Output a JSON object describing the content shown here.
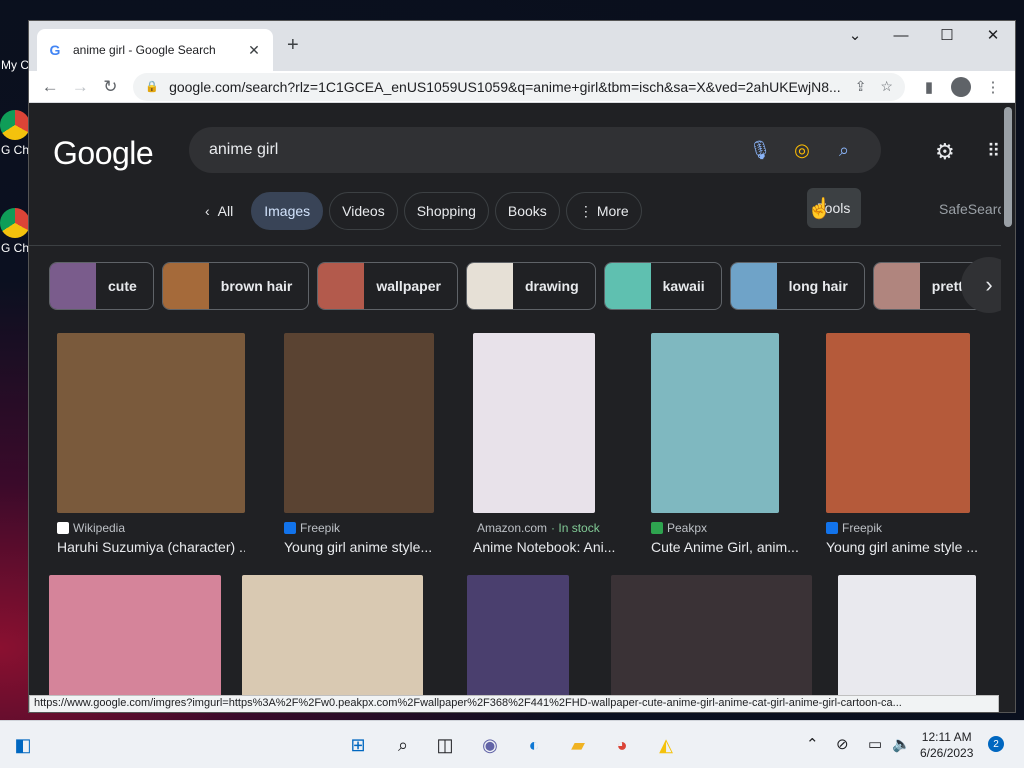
{
  "desktop": {
    "icons": [
      {
        "label": "My C"
      },
      {
        "label": "G Ch"
      },
      {
        "label": "G Ch"
      }
    ]
  },
  "browser": {
    "tab": {
      "title": "anime girl - Google Search",
      "close": "✕"
    },
    "new_tab": "+",
    "window_controls": {
      "dropdown": "⌄",
      "minimize": "—",
      "maximize": "☐",
      "close": "✕"
    },
    "url": "google.com/search?rlz=1C1GCEA_enUS1059US1059&q=anime+girl&tbm=isch&sa=X&ved=2ahUKEwjN8..."
  },
  "search": {
    "logo": "Google",
    "query": "anime girl"
  },
  "filters": {
    "all": "All",
    "items": [
      "Images",
      "Videos",
      "Shopping",
      "Books",
      "More"
    ],
    "tools": "Tools",
    "safesearch": "SafeSearch"
  },
  "related": [
    {
      "label": "cute",
      "color": "#7a5c8c"
    },
    {
      "label": "brown hair",
      "color": "#a56a3a"
    },
    {
      "label": "wallpaper",
      "color": "#b35a4c"
    },
    {
      "label": "drawing",
      "color": "#e6e0d6"
    },
    {
      "label": "kawaii",
      "color": "#5fc0b0"
    },
    {
      "label": "long hair",
      "color": "#6fa3c8"
    },
    {
      "label": "pretty",
      "color": "#b0857e"
    }
  ],
  "results": [
    {
      "source": "Wikipedia",
      "caption": "Haruhi Suzumiya (character) ...",
      "color": "#7a5a3c",
      "fav": "#ffffff"
    },
    {
      "source": "Freepik",
      "caption": "Young girl anime style...",
      "color": "#5a4332",
      "fav": "#1273eb"
    },
    {
      "source": "Amazon.com",
      "stock": "· In stock",
      "caption": "Anime Notebook: Ani...",
      "color": "#e8e2ea",
      "fav": "#ff9900"
    },
    {
      "source": "Peakpx",
      "caption": "Cute Anime Girl, anim...",
      "color": "#7fb8c0",
      "fav": "#2ea44f"
    },
    {
      "source": "Freepik",
      "caption": "Young girl anime style ...",
      "color": "#b55a3a",
      "fav": "#1273eb"
    },
    {
      "color": "#d5849a"
    },
    {
      "color": "#d9c9b2"
    },
    {
      "color": "#4a3f6e"
    },
    {
      "color": "#3a3236"
    },
    {
      "color": "#2a2f4a"
    }
  ],
  "status_url": "https://www.google.com/imgres?imgurl=https%3A%2F%2Fw0.peakpx.com%2Fwallpaper%2F368%2F441%2FHD-wallpaper-cute-anime-girl-anime-cat-girl-anime-girl-cartoon-ca...",
  "taskbar": {
    "clock_time": "12:11 AM",
    "clock_date": "6/26/2023",
    "notifications": "2"
  }
}
